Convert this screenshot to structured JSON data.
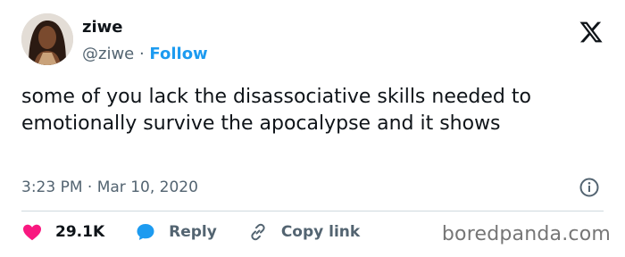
{
  "author": {
    "display_name": "ziwe",
    "handle": "@ziwe",
    "separator": " · ",
    "follow_label": "Follow"
  },
  "tweet": {
    "text": "some of you lack the disassociative skills needed to emotionally survive the apocalypse and it shows",
    "timestamp": "3:23 PM · Mar 10, 2020"
  },
  "actions": {
    "likes_count": "29.1K",
    "reply_label": "Reply",
    "copy_link_label": "Copy link"
  },
  "icons": {
    "logo": "x-logo-icon",
    "info": "info-icon",
    "like": "heart-icon",
    "reply": "chat-bubble-icon",
    "copy": "link-icon"
  },
  "colors": {
    "accent": "#1d9bf0",
    "like": "#f91880",
    "text": "#0f1419",
    "muted": "#536471"
  },
  "watermark": "boredpanda.com"
}
